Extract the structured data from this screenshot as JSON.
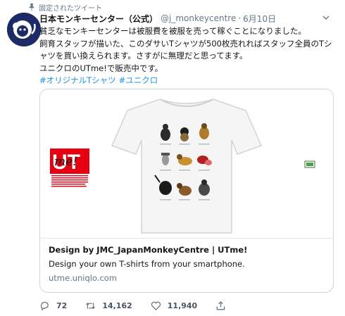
{
  "pinned_label": "固定されたツイート",
  "tweet": {
    "display_name": "日本モンキーセンター（公式）",
    "handle": "@j_monkeycentre",
    "separator": "·",
    "time": "6月10日",
    "lines": [
      "貧乏なモンキーセンターは被服費を被服を売って稼ぐことになりました。",
      "飼育スタッフが描いた、このダサいTシャツが500枚売れればスタッフ全員のTシ",
      "ャツを買い換えられます。さすがに無理だと思ってます。",
      "ユニクロのUTme!で販売中です。"
    ],
    "hashtags": [
      "#オリジナルTシャツ",
      "#ユニクロ"
    ]
  },
  "card": {
    "title": "Design by JMC_JapanMonkeyCentre | UTme!",
    "description": "Design your own T-shirts from your smartphone.",
    "domain": "utme.uniqlo.com",
    "logo_text": "UT",
    "logo_script": "me!"
  },
  "actions": {
    "replies": "72",
    "retweets": "14,162",
    "likes": "11,940"
  },
  "colors": {
    "accent": "#1b95e0",
    "secondary_text": "#657786",
    "border": "#ccd6dd",
    "uniqlo_red": "#e60012",
    "avatar_navy": "#1c2a66"
  }
}
